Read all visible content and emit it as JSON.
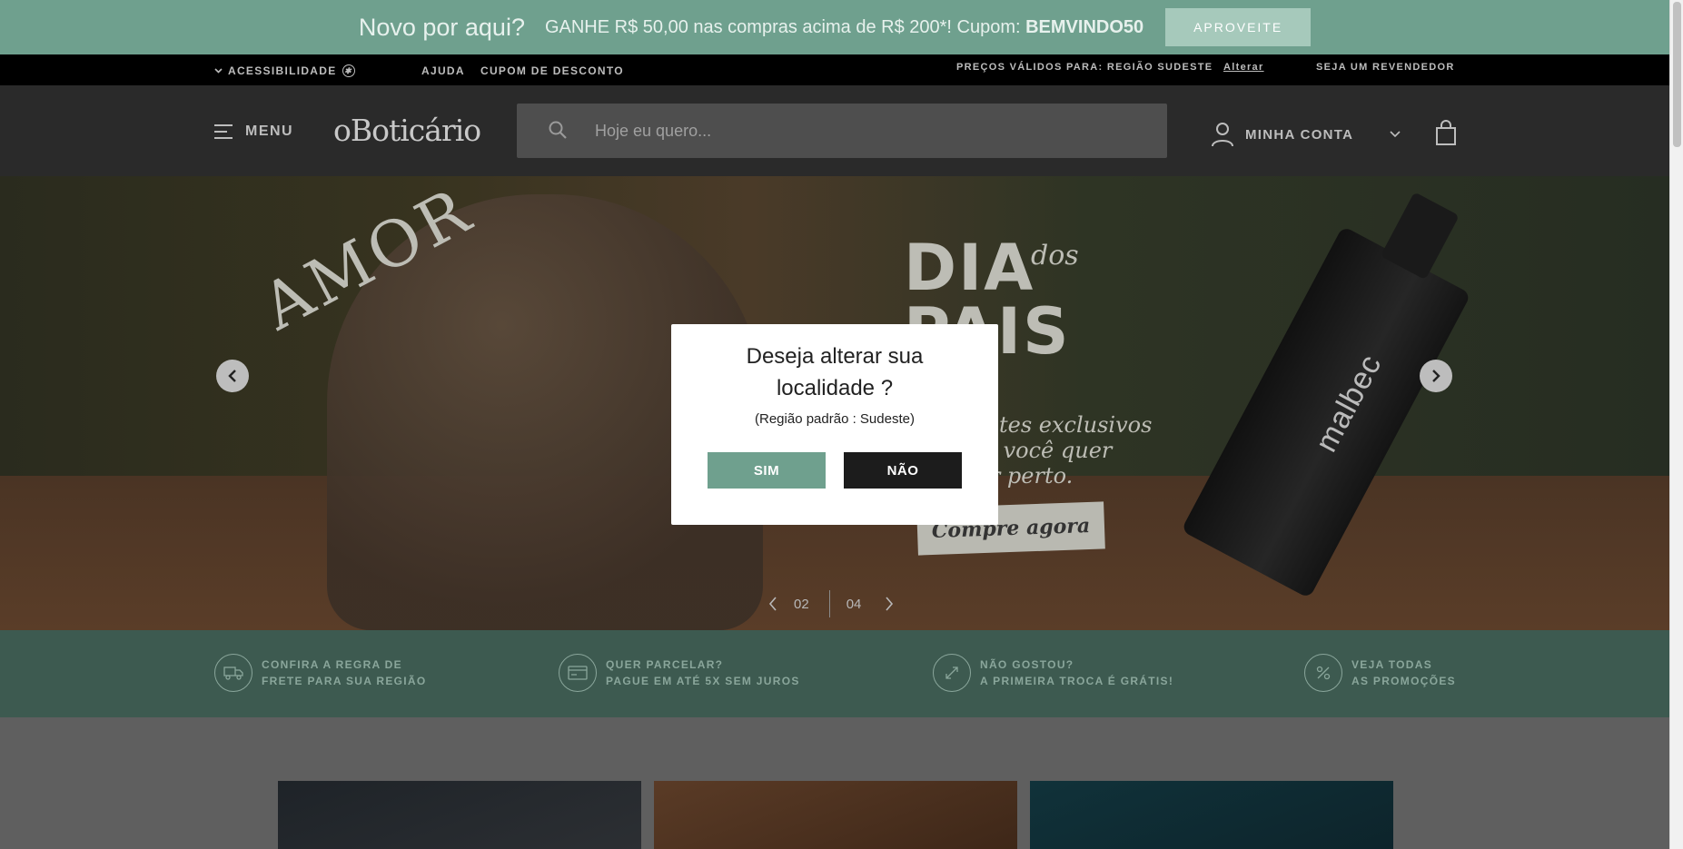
{
  "promo": {
    "headline": "Novo por aqui?",
    "text_before": "GANHE R$ 50,00 nas compras acima de R$ 200*! Cupom: ",
    "coupon_code": "BEMVINDO50",
    "button": "APROVEITE"
  },
  "util_bar": {
    "accessibility": "ACESSIBILIDADE",
    "help": "AJUDA",
    "coupon": "CUPOM DE DESCONTO",
    "prices": "PREÇOS VÁLIDOS PARA: REGIÃO SUDESTE",
    "change": "Alterar",
    "reseller": "SEJA UM REVENDEDOR"
  },
  "header": {
    "menu": "MENU",
    "logo": "oBoticário",
    "search_placeholder": "Hoje eu quero...",
    "account": "MINHA CONTA"
  },
  "hero": {
    "amor": "AMOR",
    "dia": "DIA",
    "dos": "dos",
    "pais": "PAIS",
    "tagline_1": "tes exclusivos",
    "tagline_2": "em você quer",
    "tagline_3": "por perto.",
    "cta": "Compre agora",
    "product": "malbec",
    "current_slide": "02",
    "total_slides": "04"
  },
  "benefits": [
    {
      "line1": "CONFIRA A REGRA DE",
      "line2": "FRETE PARA SUA REGIÃO",
      "icon": "truck-icon"
    },
    {
      "line1": "QUER PARCELAR?",
      "line2": "PAGUE EM ATÉ 5X SEM JUROS",
      "icon": "card-icon"
    },
    {
      "line1": "NÃO GOSTOU?",
      "line2": "A PRIMEIRA TROCA É GRÁTIS!",
      "icon": "exchange-icon"
    },
    {
      "line1": "VEJA TODAS",
      "line2": "AS PROMOÇÕES",
      "icon": "percent-icon"
    }
  ],
  "modal": {
    "title_line1": "Deseja alterar sua",
    "title_line2": "localidade ?",
    "subtitle": "(Região padrão : Sudeste)",
    "yes": "SIM",
    "no": "NÃO"
  },
  "colors": {
    "brand_green": "#6fa08e",
    "dark_green": "#3d5a50",
    "no_button": "#1c1c1c"
  }
}
